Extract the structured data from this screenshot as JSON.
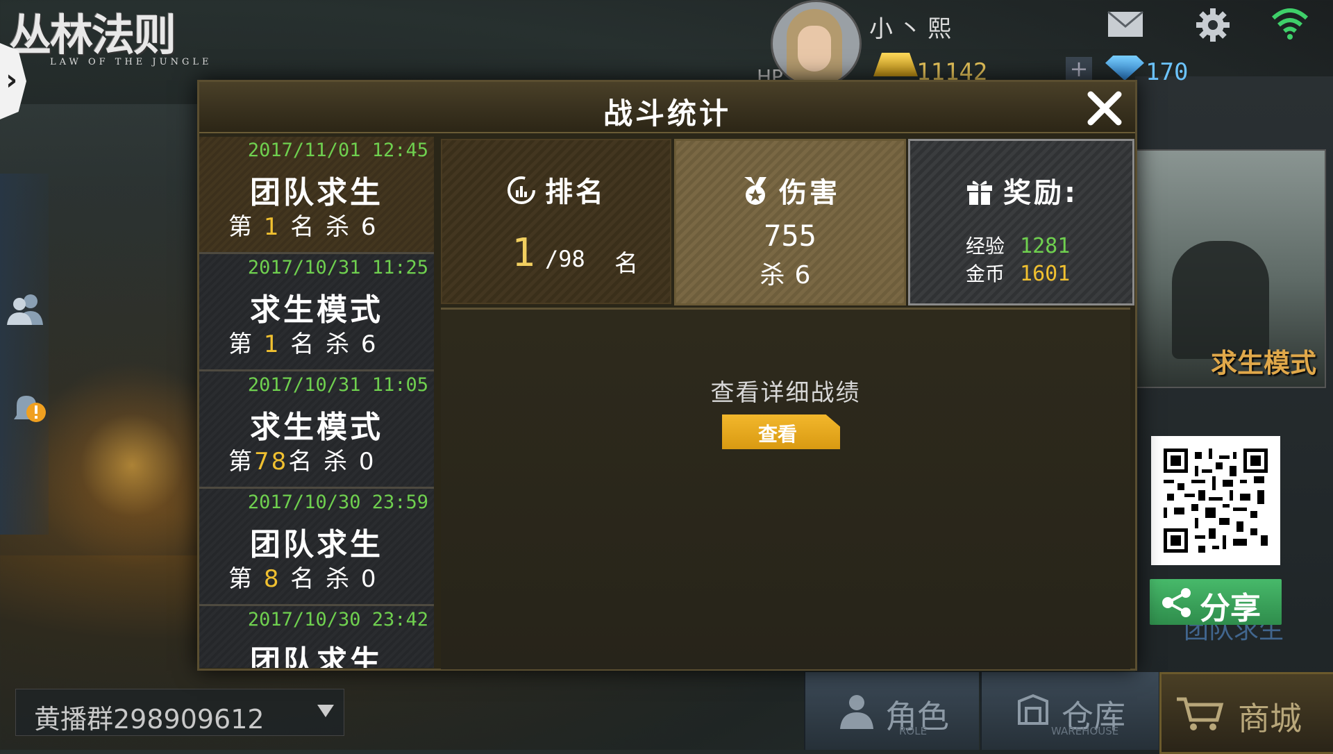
{
  "logo": {
    "title": "丛林法则",
    "subtitle": "LAW OF THE JUNGLE"
  },
  "top_bar": {
    "player_name": "小丶熙",
    "gold": "11142",
    "diamonds": "170",
    "hp_fragment": "HP"
  },
  "modal": {
    "title": "战斗统计",
    "matches": [
      {
        "datetime": "2017/11/01 12:45",
        "mode": "团队求生",
        "prefix": "第 ",
        "rank": "1",
        "suffix": " 名 杀 6"
      },
      {
        "datetime": "2017/10/31 11:25",
        "mode": "求生模式",
        "prefix": "第 ",
        "rank": "1",
        "suffix": " 名 杀 6"
      },
      {
        "datetime": "2017/10/31 11:05",
        "mode": "求生模式",
        "prefix": "第",
        "rank": "78",
        "suffix": "名 杀 0"
      },
      {
        "datetime": "2017/10/30 23:59",
        "mode": "团队求生",
        "prefix": "第 ",
        "rank": "8",
        "suffix": " 名 杀 0"
      },
      {
        "datetime": "2017/10/30 23:42",
        "mode": "团队求生",
        "prefix": "",
        "rank": "",
        "suffix": ""
      }
    ],
    "rank_card": {
      "title": "排名",
      "rank": "1",
      "total": "/98",
      "unit": "名"
    },
    "damage_card": {
      "title": "伤害",
      "damage": "755",
      "kills": "杀6"
    },
    "reward_card": {
      "title": "奖励:",
      "exp_label": "经验",
      "exp_value": "1281",
      "coin_label": "金币",
      "coin_value": "1601"
    },
    "detail": {
      "label": "查看详细战绩",
      "button": "查看"
    }
  },
  "right_panel": {
    "mode_label": "求生模式",
    "share_label": "分享",
    "under_share_label": "团队求生"
  },
  "bottom_bar": {
    "chat_group": "黄播群298909612",
    "role": {
      "label": "角色",
      "sub": "ROLE"
    },
    "warehouse": {
      "label": "仓库",
      "sub": "WAREHOUSE"
    },
    "shop": {
      "label": "商城"
    }
  },
  "colors": {
    "accent_gold": "#f0c030",
    "accent_green": "#6fd04f",
    "view_button": "#e5a81e",
    "share_button": "#3aa35a"
  },
  "icons": [
    "expand-arrow-icon",
    "friends-icon",
    "notice-icon",
    "mail-icon",
    "gear-icon",
    "wifi-icon",
    "gold-icon",
    "diamond-icon",
    "rank-icon",
    "medal-icon",
    "gift-icon",
    "share-icon",
    "close-icon",
    "role-icon",
    "warehouse-icon",
    "cart-icon",
    "dropdown-caret-icon"
  ]
}
